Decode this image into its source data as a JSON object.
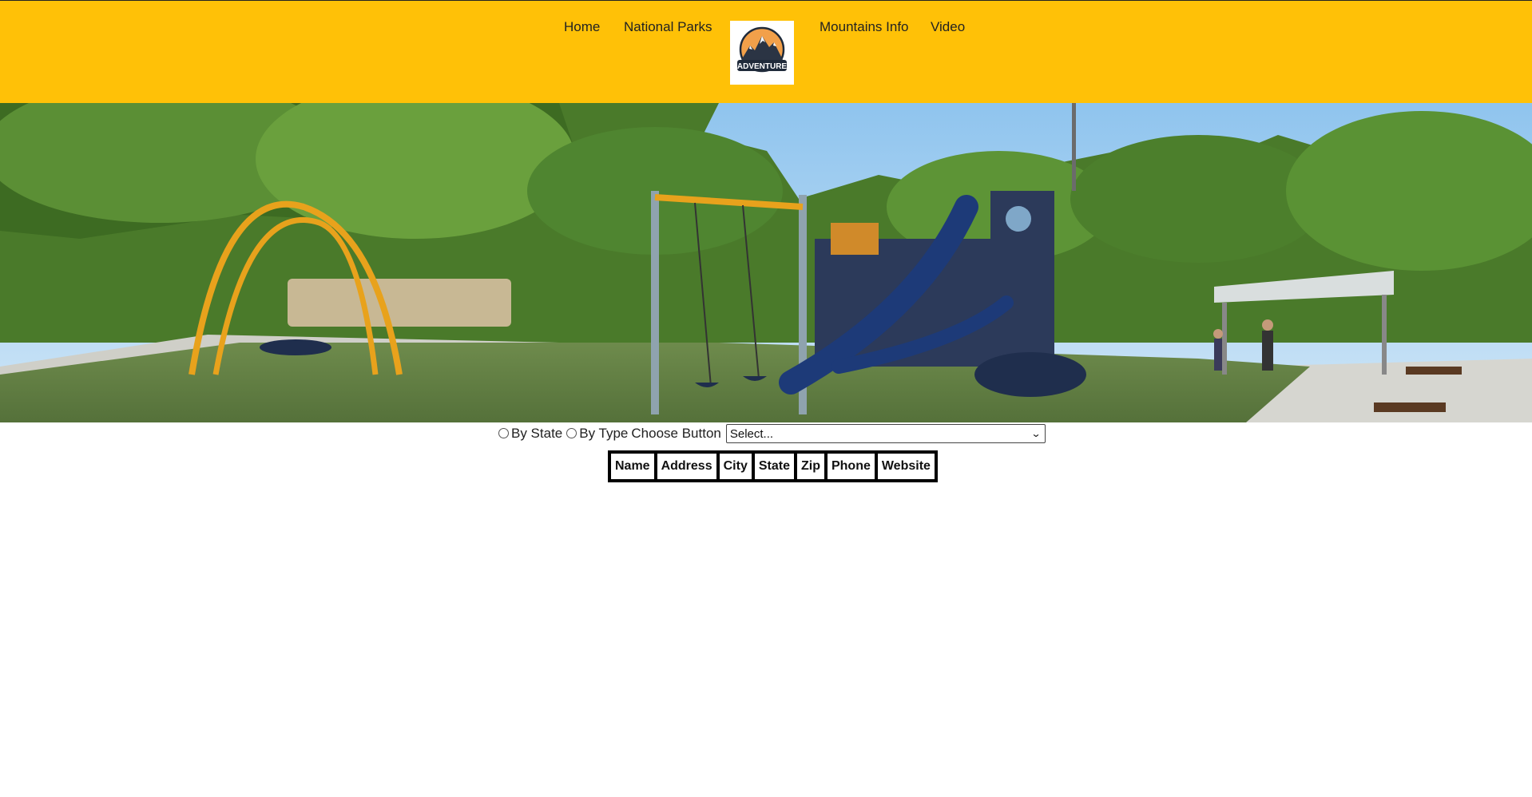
{
  "nav": {
    "links": [
      "Home",
      "National Parks",
      "Mountains Info",
      "Video"
    ],
    "logo_text": "ADVENTURE"
  },
  "colors": {
    "header_bg": "#FFC107",
    "nav_text": "#222222"
  },
  "hero": {
    "subject": "playground-photo"
  },
  "filter": {
    "radio_by_state": "By State",
    "radio_by_type": "By Type",
    "choose_label": "Choose Button",
    "select_value": "Select..."
  },
  "table": {
    "headers": [
      "Name",
      "Address",
      "City",
      "State",
      "Zip",
      "Phone",
      "Website"
    ],
    "rows": []
  }
}
